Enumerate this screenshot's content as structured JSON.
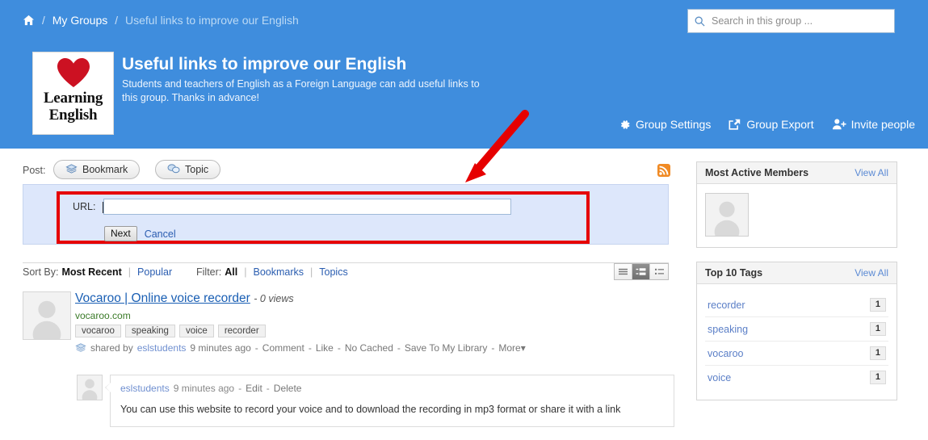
{
  "breadcrumb": {
    "home_icon": "home-icon",
    "sep": "/",
    "my_groups": "My Groups",
    "current": "Useful links to improve our English"
  },
  "search": {
    "icon": "search-icon",
    "placeholder": "Search in this group ...",
    "value": ""
  },
  "group": {
    "logo_text_line1": "Learning",
    "logo_text_line2": "English",
    "logo_icon": "heart-icon",
    "title": "Useful links to improve our English",
    "description": "Students and teachers of English as a Foreign Language can add useful links to this group. Thanks in advance!",
    "actions": [
      {
        "label": "Group Settings",
        "icon": "gear-icon"
      },
      {
        "label": "Group Export",
        "icon": "export-icon"
      },
      {
        "label": "Invite people",
        "icon": "person-add-icon"
      }
    ]
  },
  "post_bar": {
    "label": "Post:",
    "bookmark_label": "Bookmark",
    "bookmark_icon": "bookmark-layers-icon",
    "topic_label": "Topic",
    "topic_icon": "speech-bubbles-icon",
    "rss_icon": "rss-icon"
  },
  "url_form": {
    "label": "URL:",
    "value": "",
    "next_label": "Next",
    "cancel_label": "Cancel",
    "highlight_color": "#e60000",
    "panel_color": "#dde7fb"
  },
  "annotation": {
    "arrow_icon": "red-arrow-icon",
    "arrow_color": "#e60000"
  },
  "sort_filter": {
    "sort_label": "Sort By:",
    "sort_active": "Most Recent",
    "sort_pipe": "|",
    "sort_other": "Popular",
    "filter_label": "Filter:",
    "filter_active": "All",
    "filter_pipe1": "|",
    "filter_bookmarks": "Bookmarks",
    "filter_pipe2": "|",
    "filter_topics": "Topics",
    "view_modes": [
      {
        "name": "list-view-icon",
        "active": false
      },
      {
        "name": "detail-view-icon",
        "active": true
      },
      {
        "name": "compact-view-icon",
        "active": false
      }
    ]
  },
  "post": {
    "avatar_icon": "user-avatar-placeholder",
    "title": "Vocaroo | Online voice recorder",
    "views": "- 0 views",
    "url": "vocaroo.com",
    "tags": [
      "vocaroo",
      "speaking",
      "voice",
      "recorder"
    ],
    "meta": {
      "icon": "bookmark-layers-icon",
      "shared_by": "shared by",
      "user": "eslstudents",
      "time": "9 minutes ago",
      "dash1": "-",
      "comment": "Comment",
      "dash2": "-",
      "like": "Like",
      "dash3": "-",
      "no_cached": "No Cached",
      "dash4": "-",
      "save": "Save To My Library",
      "dash5": "-",
      "more": "More▾"
    }
  },
  "comment": {
    "avatar_icon": "user-avatar-placeholder",
    "user": "eslstudents",
    "time": "9 minutes ago",
    "dash1": "-",
    "edit": "Edit",
    "dash2": "-",
    "delete": "Delete",
    "text": "You can use this website to record your voice and to download the recording in mp3 format or share it with a link"
  },
  "sidebar": {
    "members_widget": {
      "title": "Most Active Members",
      "view_all": "View All",
      "avatar_icon": "user-avatar-placeholder"
    },
    "tags_widget": {
      "title": "Top 10 Tags",
      "view_all": "View All",
      "tags": [
        {
          "name": "recorder",
          "count": "1"
        },
        {
          "name": "speaking",
          "count": "1"
        },
        {
          "name": "vocaroo",
          "count": "1"
        },
        {
          "name": "voice",
          "count": "1"
        }
      ]
    }
  },
  "theme": {
    "header_blue": "#3f8ddd",
    "link_blue": "#1a5fb4",
    "url_green": "#3a7a28",
    "annotation_red": "#e60000"
  }
}
